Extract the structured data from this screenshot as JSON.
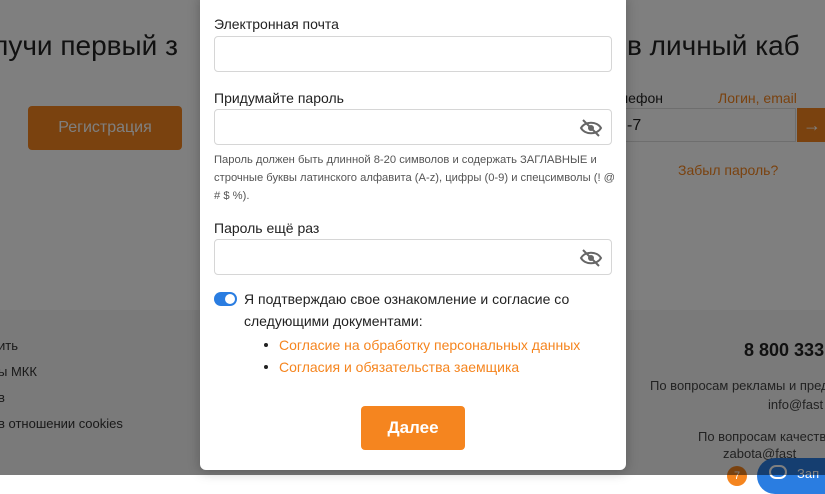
{
  "background": {
    "headline_left": "лучи первый з",
    "headline_right": "в личный каб",
    "register_button": "Регистрация",
    "phone_label": "лефон",
    "login_link": "Логин, email",
    "phone_value": "-7",
    "forgot_link": "Забыл пароль?",
    "footer_links": [
      "ить",
      "ы МКК",
      "в",
      "в отношении cookies"
    ],
    "hotline": "8 800 333",
    "footer_right": [
      "По вопросам рекламы и пред",
      "info@fast",
      "По вопросам качеств",
      "zabota@fast"
    ],
    "chat_badge": "7",
    "chat_label": "Зап"
  },
  "modal": {
    "email_label": "Электронная почта",
    "email_value": "",
    "password_label": "Придумайте пароль",
    "password_value": "",
    "password_hint": "Пароль должен быть длинной 8-20 символов и содержать ЗАГЛАВНЫЕ и строчные буквы латинского алфавита (A-z), цифры (0-9) и спецсимволы (! @ # $ %).",
    "password_repeat_label": "Пароль ещё раз",
    "password_repeat_value": "",
    "consent_toggle_on": true,
    "consent_text": "Я подтверждаю свое ознакомление и согласие со следующими документами:",
    "documents": [
      "Согласие на обработку персональных данных",
      "Согласия и обязательства заемщика"
    ],
    "next_button": "Далее"
  },
  "colors": {
    "accent": "#f5851f",
    "toggle": "#2a7de1",
    "overlay": "rgba(0,0,0,0.5)"
  },
  "icons": {
    "password_visibility": "eye-off-icon",
    "login_submit": "arrow-right-icon",
    "chat": "chat-bubble-icon"
  }
}
